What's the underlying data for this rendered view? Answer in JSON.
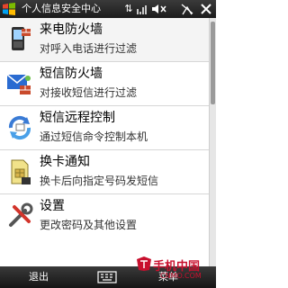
{
  "status_bar": {
    "title": "个人信息安全中心",
    "icons": [
      "windows-start-icon",
      "sync-icon",
      "signal-icon",
      "volume-muted-icon",
      "antenna-off-icon",
      "close-icon"
    ]
  },
  "items": [
    {
      "title": "来电防火墙",
      "desc": "对呼入电话进行过滤",
      "icon": "phone-firewall-icon"
    },
    {
      "title": "短信防火墙",
      "desc": "对接收短信进行过滤",
      "icon": "sms-firewall-icon"
    },
    {
      "title": "短信远程控制",
      "desc": "通过短信命令控制本机",
      "icon": "sms-remote-control-icon"
    },
    {
      "title": "换卡通知",
      "desc": "换卡后向指定号码发短信",
      "icon": "sim-change-icon"
    },
    {
      "title": "设置",
      "desc": "更改密码及其他设置",
      "icon": "settings-icon"
    }
  ],
  "soft_keys": {
    "left": "退出",
    "right": "菜单"
  },
  "watermark": {
    "brand": "手机中国",
    "url": "CNMO.COM"
  },
  "colors": {
    "bar": "#2a2a2a",
    "accent": "#c8102e"
  }
}
